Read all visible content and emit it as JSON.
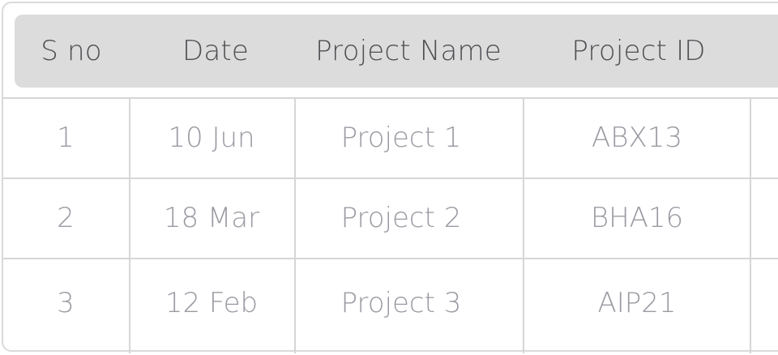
{
  "table": {
    "headers": [
      "S no",
      "Date",
      "Project Name",
      "Project ID"
    ],
    "rows": [
      [
        "1",
        "10 Jun",
        "Project 1",
        "ABX13"
      ],
      [
        "2",
        "18 Mar",
        "Project 2",
        "BHA16"
      ],
      [
        "3",
        "12 Feb",
        "Project 3",
        "AIP21"
      ]
    ]
  },
  "colors": {
    "header_bg": "#dcdcdc",
    "header_text": "#4f4f54",
    "cell_text": "#9a9aa2",
    "grid_line": "#d6d6d6"
  }
}
